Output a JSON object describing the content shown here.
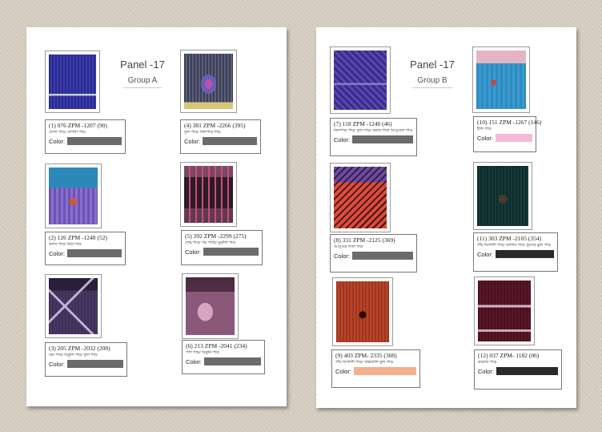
{
  "colors": {
    "redaction": "#6b6b6b",
    "pink": "#f5b8d6",
    "salmon": "#f4b08e",
    "dark": "#2a2a2a"
  },
  "group_a": {
    "panel_title": "Panel -17",
    "group_label": "Group A",
    "items": [
      {
        "code": "(1) 076 ZPM -1207 (90)",
        "desc": "লেখা পাড়/ টেপলা পাড়",
        "color_label": "Color:",
        "chip": "#6b6b6b"
      },
      {
        "code": "(4) 381 ZPM -2266 (395)",
        "desc": "ফুল পাড়/ বিলপাড় পাড়",
        "color_label": "Color:",
        "chip": "#6b6b6b"
      },
      {
        "code": "(2) 126 ZPM -1248 (52)",
        "desc": "কলস পাড়/ মিঠা পাড়",
        "color_label": "Color:",
        "chip": "#6b6b6b"
      },
      {
        "code": "(5) 392 ZPM -2299 (275)",
        "desc": "লেহ পাড়/ পদ্ম পাড়ি/ মুরালি পাড়",
        "color_label": "Color:",
        "chip": "#6b6b6b"
      },
      {
        "code": "(3) 205 ZPM -2032 (208)",
        "desc": "বরা পাড়/ চিকুনি পাড়/ ফুল পাড়",
        "color_label": "Color:",
        "chip": "#6b6b6b"
      },
      {
        "code": "(6) 213 ZPM -2041 (234)",
        "desc": "পাশ পাড়/ চিকুনি পাড়",
        "color_label": "Color:",
        "chip": "#6b6b6b"
      }
    ]
  },
  "group_b": {
    "panel_title": "Panel -17",
    "group_label": "Group B",
    "items": [
      {
        "code": "(7) 118 ZPM -1240 (46)",
        "desc": "মিলপাড় পাড়/ ফুল পাড়/ করাত দিয়া আঙ্গুল পাড়",
        "color_label": "Color:",
        "chip": "#6b6b6b"
      },
      {
        "code": "(10) 151 ZPM -1267 (146)",
        "desc": "ইন্দি পাড়",
        "color_label": "Color:",
        "chip": "#f5b8d6"
      },
      {
        "code": "(8) 331 ZPM -2125 (369)",
        "desc": "আঙ্গুর লতা পাড়",
        "color_label": "Color:",
        "chip": "#6b6b6b"
      },
      {
        "code": "(11) 303 ZPM -2105 (354)",
        "desc": "পাঁচ ডিগালী পাড়/ ডালিম পাড়/ ফুলের ঝুল পাড়",
        "color_label": "Color:",
        "chip": "#2a2a2a"
      },
      {
        "code": "(9) 403 ZPM- 2335 (308)",
        "desc": "পাঁচ ডিগালী পাড়/ বাহারালি ফুল পাড়",
        "color_label": "Color:",
        "chip": "#f4b08e"
      },
      {
        "code": "(12) 037 ZPM- 1182 (06)",
        "desc": "কারাজ পাড়",
        "color_label": "Color:",
        "chip": "#2a2a2a"
      }
    ]
  }
}
